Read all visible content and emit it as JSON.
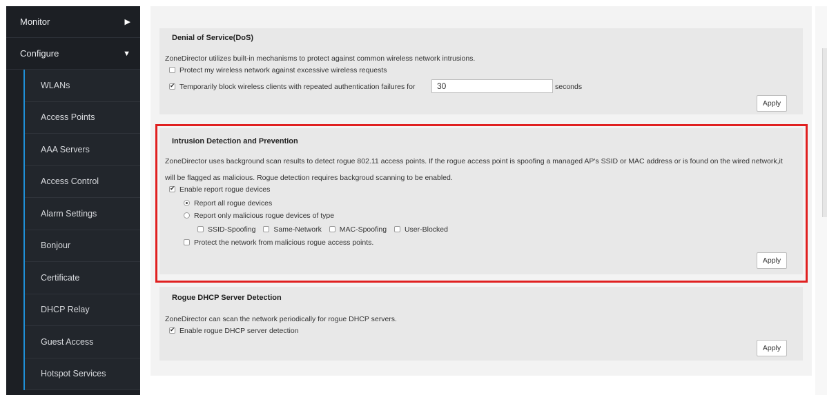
{
  "sidebar": {
    "monitor": "Monitor",
    "configure": "Configure",
    "items": [
      {
        "label": "WLANs"
      },
      {
        "label": "Access Points"
      },
      {
        "label": "AAA Servers"
      },
      {
        "label": "Access Control"
      },
      {
        "label": "Alarm Settings"
      },
      {
        "label": "Bonjour"
      },
      {
        "label": "Certificate"
      },
      {
        "label": "DHCP Relay"
      },
      {
        "label": "Guest Access"
      },
      {
        "label": "Hotspot Services"
      }
    ]
  },
  "dos": {
    "title": "Denial of Service(DoS)",
    "description": "ZoneDirector utilizes built-in mechanisms to protect against common wireless network intrusions.",
    "protect_label": "Protect my wireless network against excessive wireless requests",
    "protect_checked": false,
    "block_label": "Temporarily block wireless clients with repeated authentication failures for",
    "block_checked": true,
    "block_value": "30",
    "block_unit": "seconds",
    "apply": "Apply"
  },
  "ids": {
    "title": "Intrusion Detection and Prevention",
    "description_line1": "ZoneDirector uses background scan results to detect rogue 802.11 access points. If the rogue access point is spoofing a managed AP's SSID or MAC address or is found on the wired network,it",
    "description_line2": "will be flagged as malicious. Rogue detection requires backgroud scanning to be enabled.",
    "enable_report": "Enable report rogue devices",
    "enable_report_checked": true,
    "report_all": "Report all rogue devices",
    "report_all_selected": true,
    "report_malicious": "Report only malicious rogue devices of type",
    "report_malicious_selected": false,
    "types": [
      "SSID-Spoofing",
      "Same-Network",
      "MAC-Spoofing",
      "User-Blocked"
    ],
    "protect_label": "Protect the network from malicious rogue access points.",
    "protect_checked": false,
    "apply": "Apply"
  },
  "dhcp": {
    "title": "Rogue DHCP Server Detection",
    "description": "ZoneDirector can scan the network periodically for rogue DHCP servers.",
    "enable_label": "Enable rogue DHCP server detection",
    "enable_checked": true,
    "apply": "Apply"
  },
  "colors": {
    "sidebar_bg": "#1c1f24",
    "accent": "#1f8fd6",
    "highlight": "#e02020",
    "panel_bg": "#e8e8e8"
  }
}
